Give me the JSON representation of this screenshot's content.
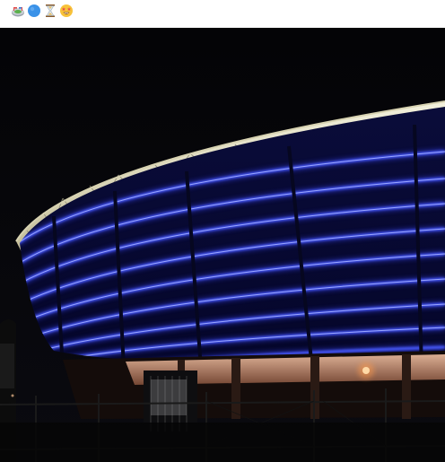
{
  "caption": {
    "emojis": [
      "stadium-emoji",
      "blue-circle-emoji",
      "hourglass-emoji",
      "star-struck-emoji"
    ]
  },
  "photo": {
    "subject": "stadium-at-night",
    "colors": {
      "sky": "#050508",
      "led_blue": "#2a35ff",
      "led_glow": "#5a6cff",
      "roof_light": "#f3efcf",
      "concourse": "#d9a48a"
    }
  }
}
